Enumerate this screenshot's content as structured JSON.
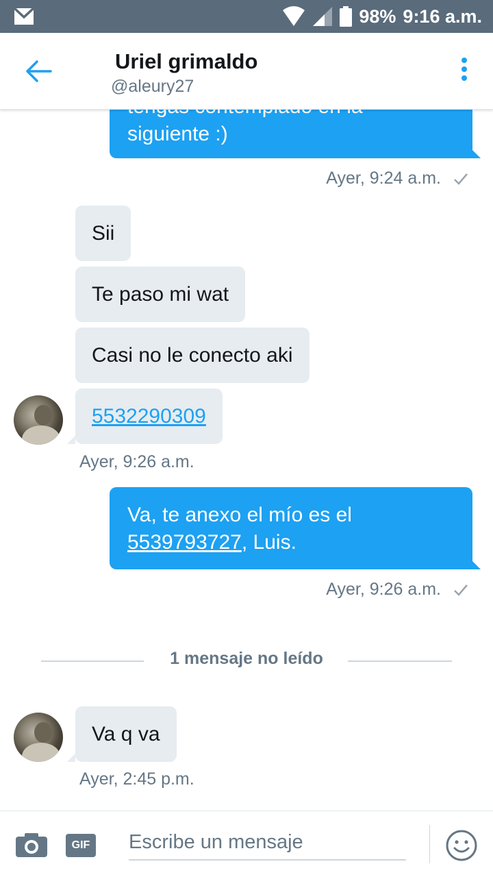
{
  "status_bar": {
    "battery": "98%",
    "time": "9:16 a.m."
  },
  "header": {
    "name": "Uriel grimaldo",
    "handle": "@aleury27"
  },
  "messages": [
    {
      "direction": "out",
      "line1": "tengas contemplado en la",
      "line2": "siguiente :)",
      "time": "Ayer, 9:24 a.m."
    },
    {
      "direction": "in",
      "text": "Sii"
    },
    {
      "direction": "in",
      "text": "Te paso mi wat"
    },
    {
      "direction": "in",
      "text": "Casi no le conecto aki"
    },
    {
      "direction": "in",
      "text": "5532290309",
      "time": "Ayer, 9:26 a.m."
    },
    {
      "direction": "out",
      "line1": "Va, te anexo el mío es el",
      "link": "5539793727",
      "after": ", Luis.",
      "time": "Ayer, 9:26 a.m."
    },
    {
      "direction": "in",
      "text": "Va q va",
      "time": "Ayer, 2:45 p.m."
    }
  ],
  "unread_divider": "1 mensaje no leído",
  "composer": {
    "gif_label": "GIF",
    "placeholder": "Escribe un mensaje"
  },
  "colors": {
    "accent": "#1da1f2",
    "status_bar": "#5a6b7b",
    "incoming_bubble": "#e6ecf0",
    "secondary_text": "#657786"
  }
}
